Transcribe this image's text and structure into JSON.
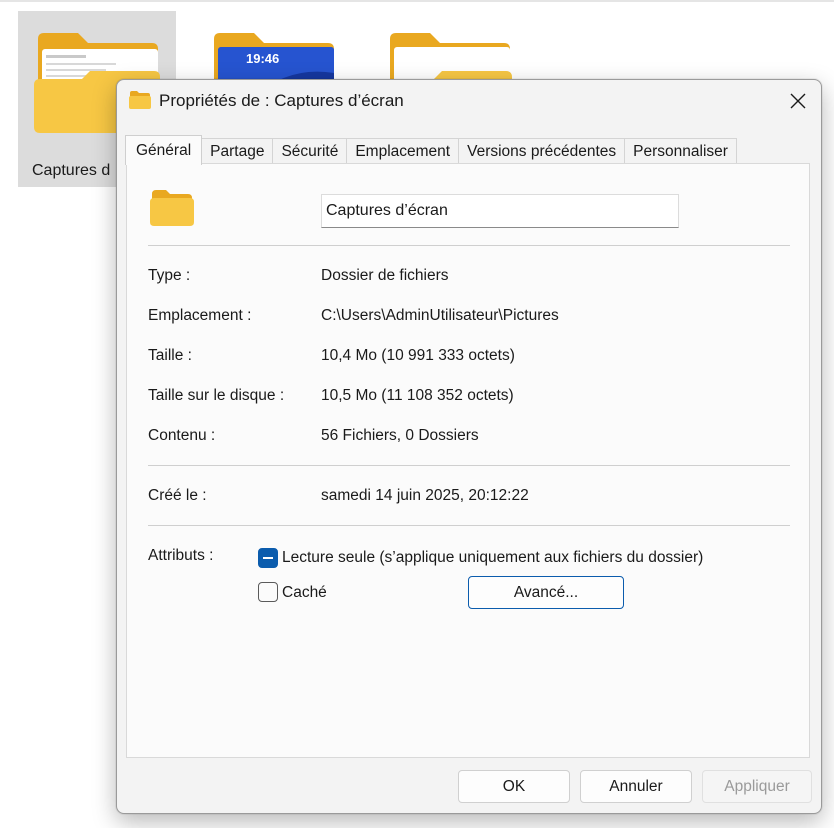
{
  "explorer": {
    "selected_item_label": "Captures d",
    "phone_time": "19:46"
  },
  "dialog": {
    "title": "Propriétés de : Captures d’écran",
    "tabs": [
      {
        "label": "Général",
        "active": true
      },
      {
        "label": "Partage",
        "active": false
      },
      {
        "label": "Sécurité",
        "active": false
      },
      {
        "label": "Emplacement",
        "active": false
      },
      {
        "label": "Versions précédentes",
        "active": false
      },
      {
        "label": "Personnaliser",
        "active": false
      }
    ],
    "folder_name": "Captures d’écran",
    "properties": {
      "type_label": "Type :",
      "type_value": "Dossier de fichiers",
      "location_label": "Emplacement :",
      "location_value": "C:\\Users\\AdminUtilisateur\\Pictures",
      "size_label": "Taille :",
      "size_value": "10,4 Mo (10 991 333 octets)",
      "disk_size_label": "Taille sur le disque :",
      "disk_size_value": "10,5 Mo (11 108 352 octets)",
      "contents_label": "Contenu :",
      "contents_value": "56 Fichiers, 0 Dossiers",
      "created_label": "Créé le :",
      "created_value": "samedi 14 juin 2025, 20:12:22"
    },
    "attributes": {
      "label": "Attributs :",
      "readonly_label": "Lecture seule (s’applique uniquement aux fichiers du dossier)",
      "hidden_label": "Caché",
      "advanced_button": "Avancé..."
    },
    "buttons": {
      "ok": "OK",
      "cancel": "Annuler",
      "apply": "Appliquer"
    }
  },
  "colors": {
    "accent": "#0b5cad",
    "folder_yellow": "#f7c744",
    "folder_back": "#e9a820"
  }
}
